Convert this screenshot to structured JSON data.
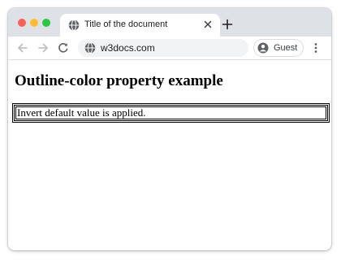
{
  "browser": {
    "tab": {
      "title": "Title of the document"
    },
    "address_bar": {
      "url": "w3docs.com"
    },
    "profile": {
      "label": "Guest"
    },
    "icons": {
      "traffic_lights": [
        "close",
        "minimize",
        "maximize"
      ],
      "tab_icon": "globe-icon",
      "tab_close": "close-icon",
      "new_tab": "plus-icon",
      "back": "arrow-left-icon",
      "forward": "arrow-right-icon",
      "reload": "reload-icon",
      "site_info": "globe-icon",
      "profile": "person-icon",
      "menu": "more-vertical-icon"
    },
    "colors": {
      "tabstrip": "#dee1e6",
      "close": "#ff5f57",
      "minimize": "#febc2e",
      "maximize": "#28c840"
    }
  },
  "page": {
    "heading": "Outline-color property example",
    "box_text": "Invert default value is applied."
  }
}
